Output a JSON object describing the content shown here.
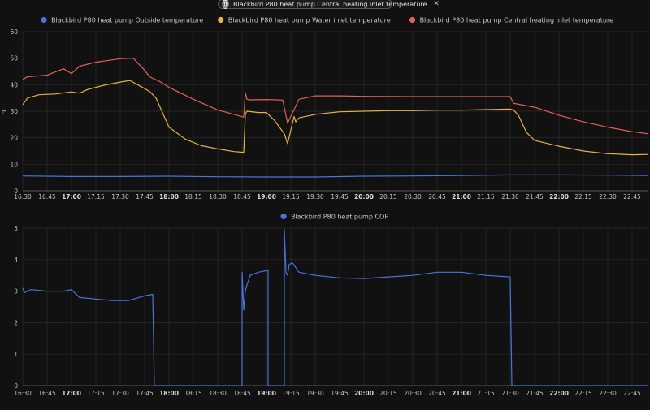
{
  "filter_chip": {
    "label": "Blackbird P80 heat pump Central heating inlet temperature",
    "close_glyph": "✕",
    "icon": "heat-pump-icon"
  },
  "chart_data": [
    {
      "type": "line",
      "title": "",
      "xlabel": "",
      "ylabel": "°C",
      "ylim": [
        0,
        60
      ],
      "yticks": [
        0,
        10,
        20,
        30,
        40,
        50,
        60
      ],
      "xlim": [
        "16:30",
        "22:55"
      ],
      "xticks": [
        "16:30",
        "16:45",
        "17:00",
        "17:15",
        "17:30",
        "17:45",
        "18:00",
        "18:15",
        "18:30",
        "18:45",
        "19:00",
        "19:15",
        "19:30",
        "19:45",
        "20:00",
        "20:15",
        "20:30",
        "20:45",
        "21:00",
        "21:15",
        "21:30",
        "21:45",
        "22:00",
        "22:15",
        "22:30",
        "22:45"
      ],
      "bold_xticks": [
        "17:00",
        "18:00",
        "19:00",
        "20:00",
        "21:00",
        "22:00"
      ],
      "grid": true,
      "legend": "top-center",
      "series": [
        {
          "name": "Blackbird P80 heat pump Outside temperature",
          "color": "#4a74d8",
          "x": [
            "16:30",
            "17:00",
            "17:30",
            "18:00",
            "18:30",
            "19:00",
            "19:30",
            "20:00",
            "20:30",
            "21:00",
            "21:30",
            "22:00",
            "22:30",
            "22:55"
          ],
          "y": [
            5.6,
            5.4,
            5.4,
            5.5,
            5.3,
            5.2,
            5.2,
            5.5,
            5.6,
            5.8,
            6.0,
            6.0,
            5.9,
            5.8
          ]
        },
        {
          "name": "Blackbird P80 heat pump Water inlet temperature",
          "color": "#e6b04a",
          "x": [
            "16:30",
            "16:33",
            "16:40",
            "16:50",
            "17:00",
            "17:05",
            "17:10",
            "17:20",
            "17:30",
            "17:36",
            "17:45",
            "17:48",
            "17:52",
            "18:00",
            "18:10",
            "18:20",
            "18:30",
            "18:40",
            "18:46",
            "18:47",
            "18:48",
            "18:55",
            "19:00",
            "19:05",
            "19:08",
            "19:11",
            "19:13",
            "19:17",
            "19:18",
            "19:20",
            "19:30",
            "19:45",
            "20:00",
            "20:15",
            "20:30",
            "20:45",
            "21:00",
            "21:15",
            "21:30",
            "21:32",
            "21:35",
            "21:40",
            "21:45",
            "22:00",
            "22:15",
            "22:30",
            "22:45",
            "22:55"
          ],
          "y": [
            32.5,
            35.0,
            36.2,
            36.5,
            37.3,
            36.8,
            38.2,
            39.8,
            41.0,
            41.6,
            38.5,
            37.5,
            35.0,
            24.0,
            19.5,
            17.0,
            15.8,
            14.8,
            14.5,
            29.0,
            30.0,
            29.5,
            29.5,
            26.5,
            24.0,
            21.5,
            17.8,
            28.0,
            26.0,
            27.5,
            28.8,
            29.8,
            30.0,
            30.2,
            30.2,
            30.4,
            30.4,
            30.6,
            30.8,
            30.5,
            28.5,
            22.0,
            19.0,
            16.8,
            15.0,
            14.0,
            13.6,
            13.7
          ]
        },
        {
          "name": "Blackbird P80 heat pump Central heating inlet temperature",
          "color": "#e2605a",
          "x": [
            "16:30",
            "16:33",
            "16:45",
            "16:55",
            "17:00",
            "17:05",
            "17:15",
            "17:30",
            "17:38",
            "17:45",
            "17:48",
            "17:55",
            "18:00",
            "18:15",
            "18:30",
            "18:46",
            "18:47",
            "18:48",
            "18:50",
            "19:00",
            "19:10",
            "19:13",
            "19:20",
            "19:30",
            "19:45",
            "20:00",
            "20:30",
            "21:00",
            "21:15",
            "21:30",
            "21:32",
            "21:45",
            "22:00",
            "22:15",
            "22:30",
            "22:45",
            "22:55"
          ],
          "y": [
            42.0,
            43.0,
            43.6,
            46.0,
            44.2,
            47.0,
            48.5,
            49.8,
            50.0,
            45.5,
            43.0,
            41.0,
            39.0,
            34.5,
            30.5,
            27.8,
            37.0,
            34.5,
            34.3,
            34.4,
            34.2,
            25.5,
            34.5,
            35.8,
            35.8,
            35.6,
            35.5,
            35.5,
            35.5,
            35.5,
            33.0,
            31.5,
            28.5,
            26.0,
            24.0,
            22.3,
            21.5
          ]
        }
      ]
    },
    {
      "type": "line",
      "title": "",
      "xlabel": "",
      "ylabel": "",
      "ylim": [
        0,
        5
      ],
      "yticks": [
        0,
        1,
        2,
        3,
        4,
        5
      ],
      "xlim": [
        "16:30",
        "22:55"
      ],
      "xticks": [
        "16:30",
        "16:45",
        "17:00",
        "17:15",
        "17:30",
        "17:45",
        "18:00",
        "18:15",
        "18:30",
        "18:45",
        "19:00",
        "19:15",
        "19:30",
        "19:45",
        "20:00",
        "20:15",
        "20:30",
        "20:45",
        "21:00",
        "21:15",
        "21:30",
        "21:45",
        "22:00",
        "22:15",
        "22:30",
        "22:45"
      ],
      "bold_xticks": [
        "17:00",
        "18:00",
        "19:00",
        "20:00",
        "21:00",
        "22:00"
      ],
      "grid": true,
      "legend": "top-center",
      "series": [
        {
          "name": "Blackbird P80 heat pump COP",
          "color": "#4a74d8",
          "x": [
            "16:30",
            "16:31",
            "16:35",
            "16:45",
            "16:55",
            "17:00",
            "17:05",
            "17:15",
            "17:25",
            "17:35",
            "17:45",
            "17:50",
            "17:51",
            "18:00",
            "18:30",
            "18:45",
            "18:45",
            "18:46",
            "18:47",
            "18:48",
            "18:50",
            "18:55",
            "19:00",
            "19:01",
            "19:01",
            "19:04",
            "19:10",
            "19:11",
            "19:11",
            "19:12",
            "19:13",
            "19:14",
            "19:16",
            "19:20",
            "19:30",
            "19:45",
            "20:00",
            "20:15",
            "20:30",
            "20:45",
            "21:00",
            "21:15",
            "21:30",
            "21:30",
            "21:31",
            "21:45",
            "22:00",
            "22:15",
            "22:30",
            "22:45",
            "22:55"
          ],
          "y": [
            3.1,
            2.95,
            3.05,
            3.0,
            3.0,
            3.05,
            2.8,
            2.75,
            2.7,
            2.7,
            2.85,
            2.9,
            0,
            0,
            0,
            0,
            3.6,
            2.4,
            3.0,
            3.2,
            3.5,
            3.6,
            3.65,
            3.65,
            0,
            0,
            0,
            0,
            4.95,
            3.6,
            3.5,
            3.85,
            3.9,
            3.6,
            3.5,
            3.42,
            3.4,
            3.45,
            3.5,
            3.6,
            3.6,
            3.5,
            3.45,
            3.4,
            0,
            0,
            0,
            0,
            0,
            0,
            0
          ]
        }
      ]
    }
  ]
}
